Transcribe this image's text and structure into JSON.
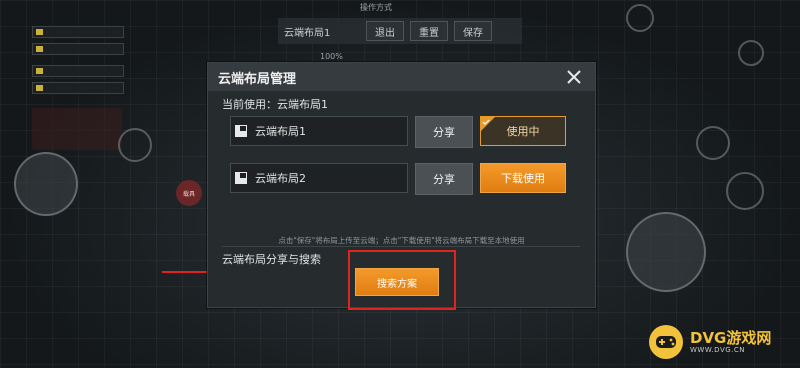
{
  "background": {
    "top_title": "操作方式",
    "toolbar": {
      "layout_label": "云端布局1",
      "exit_label": "退出",
      "reset_label": "重置",
      "save_label": "保存"
    },
    "percent": "100%",
    "red_dot_text": "载具"
  },
  "dialog": {
    "title": "云端布局管理",
    "current_use": "当前使用：云端布局1",
    "layouts": [
      {
        "name": "云端布局1",
        "share_label": "分享",
        "action_label": "使用中",
        "state": "active"
      },
      {
        "name": "云端布局2",
        "share_label": "分享",
        "action_label": "下载使用",
        "state": "download"
      }
    ],
    "hint": "点击\"保存\"将布局上传至云端；点击\"下载使用\"将云端布局下载至本地使用",
    "share_search_label": "云端布局分享与搜索",
    "search_button_label": "搜索方案"
  },
  "annotation": {
    "highlight_color": "#e0231e"
  },
  "watermark": {
    "main": "DVG游戏网",
    "sub": "WWW.DVG.CN"
  },
  "colors": {
    "accent_orange": "#f39a2a",
    "panel": "#262b2e",
    "header": "#353b3e"
  }
}
